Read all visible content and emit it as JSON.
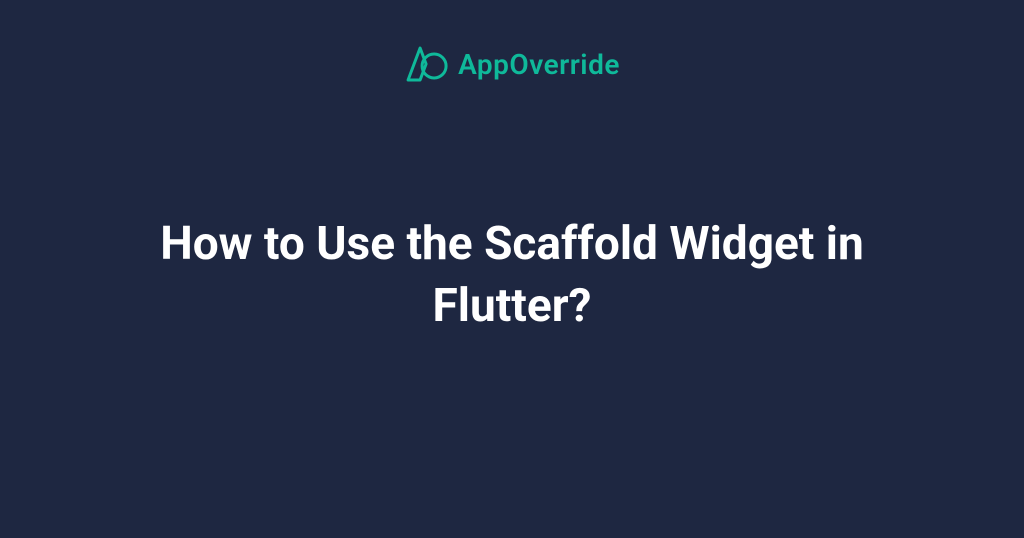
{
  "brand": {
    "name": "AppOverride",
    "colors": {
      "background": "#1e2741",
      "accent": "#0fb99a",
      "text": "#ffffff"
    }
  },
  "title": "How to Use the Scaffold Widget in Flutter?"
}
